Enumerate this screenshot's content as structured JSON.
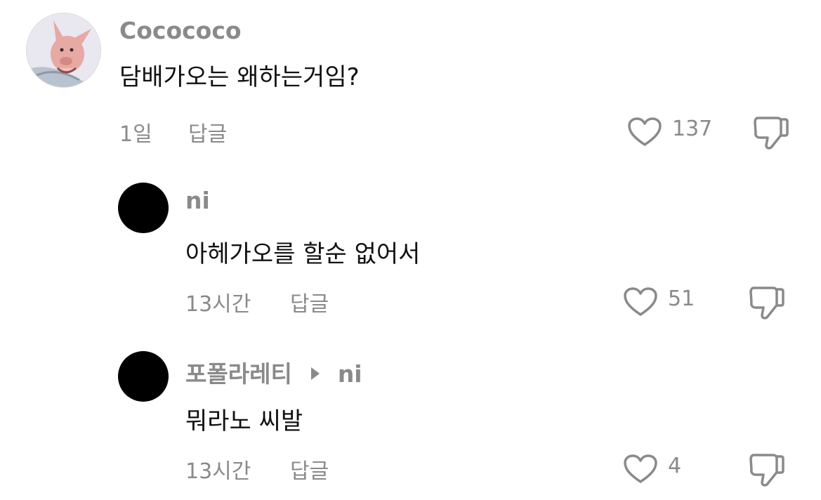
{
  "comments": [
    {
      "username": "Cocococo",
      "text": "담배가오는 왜하는거임?",
      "time": "1일",
      "reply_label": "답글",
      "likes": "137",
      "avatar": "pig-character-avatar"
    },
    {
      "username": "ni",
      "text": "아헤가오를 할순 없어서",
      "time": "13시간",
      "reply_label": "답글",
      "likes": "51",
      "avatar": "black-circle-avatar"
    },
    {
      "username": "포폴라레티",
      "reply_to": "ni",
      "text": "뭐라노 씨발",
      "time": "13시간",
      "reply_label": "답글",
      "likes": "4",
      "avatar": "black-circle-avatar"
    }
  ],
  "colors": {
    "text": "#111111",
    "muted": "#8a8a8a",
    "background": "#ffffff"
  }
}
